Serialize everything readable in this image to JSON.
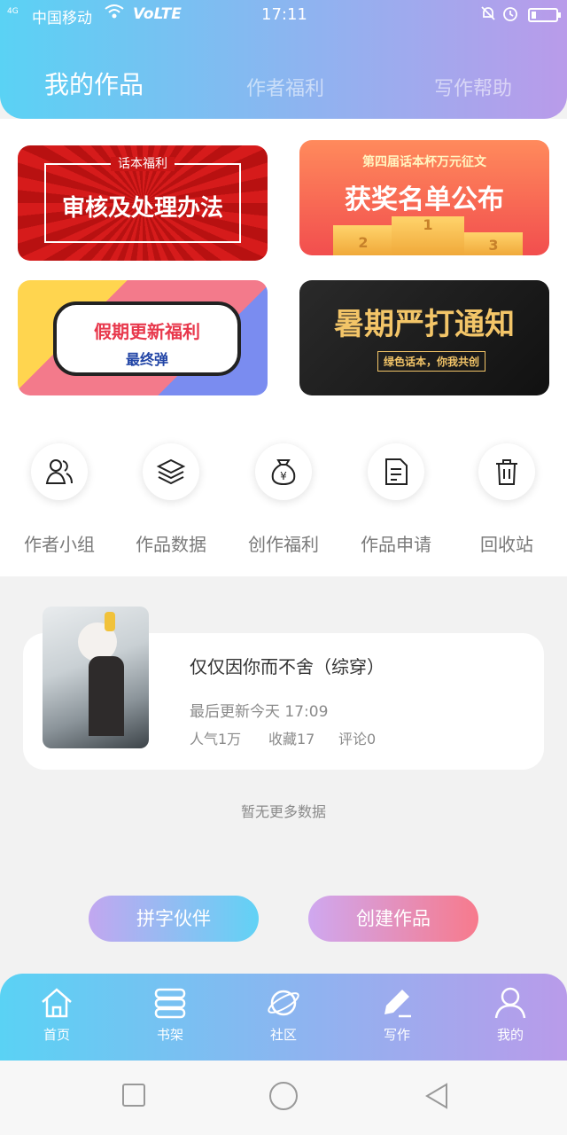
{
  "status_bar": {
    "signal_label": "4G",
    "carrier": "中国移动",
    "wifi_icon": "wifi-icon",
    "volte": "VoLTE",
    "time": "17:11",
    "icons": [
      "bell-off-icon",
      "alarm-icon",
      "battery-icon"
    ]
  },
  "header": {
    "tabs": [
      {
        "label": "我的作品",
        "active": true
      },
      {
        "label": "作者福利",
        "active": false
      },
      {
        "label": "写作帮助",
        "active": false
      }
    ]
  },
  "banners": [
    {
      "top_text": "话本福利",
      "main_text": "审核及处理办法"
    },
    {
      "top_text": "第四届话本杯万元征文",
      "main_text": "获奖名单公布",
      "podium": [
        "2",
        "1",
        "3"
      ]
    },
    {
      "main_text": "假期更新福利",
      "sub_text": "最终弹"
    },
    {
      "main_text": "暑期严打通知",
      "sub_text": "绿色话本，你我共创"
    }
  ],
  "features": [
    {
      "label": "作者小组",
      "icon": "users-icon"
    },
    {
      "label": "作品数据",
      "icon": "layers-icon"
    },
    {
      "label": "创作福利",
      "icon": "money-bag-icon"
    },
    {
      "label": "作品申请",
      "icon": "document-icon"
    },
    {
      "label": "回收站",
      "icon": "trash-icon"
    }
  ],
  "book": {
    "title": "仅仅因你而不舍（综穿）",
    "updated": "最后更新今天 17:09",
    "stats": [
      "人气1万",
      "收藏17",
      "评论0"
    ]
  },
  "no_more_text": "暂无更多数据",
  "actions": {
    "partner_label": "拼字伙伴",
    "create_label": "创建作品"
  },
  "bottom_nav": [
    {
      "label": "首页",
      "icon": "home-icon"
    },
    {
      "label": "书架",
      "icon": "bookshelf-icon"
    },
    {
      "label": "社区",
      "icon": "planet-icon"
    },
    {
      "label": "写作",
      "icon": "pen-icon"
    },
    {
      "label": "我的",
      "icon": "user-icon"
    }
  ],
  "colors": {
    "gradient_start": "#5ad2f4",
    "gradient_end": "#b99bea",
    "create_button_end": "#f77a8c"
  }
}
